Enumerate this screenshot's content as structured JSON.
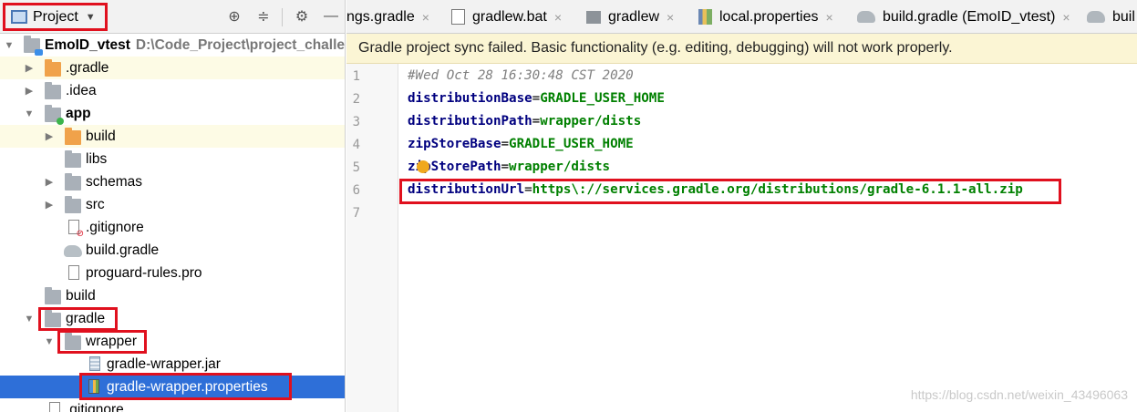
{
  "project_panel": {
    "view_selector_label": "Project",
    "tree": [
      {
        "label": "EmoID_vtest",
        "path": "D:\\Code_Project\\project_challe",
        "kind": "root"
      },
      {
        "label": ".gradle",
        "kind": "folder-orange"
      },
      {
        "label": ".idea",
        "kind": "folder"
      },
      {
        "label": "app",
        "kind": "module"
      },
      {
        "label": "build",
        "kind": "folder-orange"
      },
      {
        "label": "libs",
        "kind": "folder"
      },
      {
        "label": "schemas",
        "kind": "folder"
      },
      {
        "label": "src",
        "kind": "folder"
      },
      {
        "label": ".gitignore",
        "kind": "file-ignore"
      },
      {
        "label": "build.gradle",
        "kind": "gradle"
      },
      {
        "label": "proguard-rules.pro",
        "kind": "file"
      },
      {
        "label": "build",
        "kind": "folder"
      },
      {
        "label": "gradle",
        "kind": "folder"
      },
      {
        "label": "wrapper",
        "kind": "folder"
      },
      {
        "label": "gradle-wrapper.jar",
        "kind": "jar"
      },
      {
        "label": "gradle-wrapper.properties",
        "kind": "properties"
      },
      {
        "label": ".gitignore",
        "kind": "file-ignore"
      }
    ]
  },
  "tabs": [
    {
      "label": "ngs.gradle",
      "icon": "gradle-icon"
    },
    {
      "label": "gradlew.bat",
      "icon": "file-icon"
    },
    {
      "label": "gradlew",
      "icon": "terminal-icon"
    },
    {
      "label": "local.properties",
      "icon": "properties-icon"
    },
    {
      "label": "build.gradle (EmoID_vtest)",
      "icon": "gradle-icon"
    },
    {
      "label": "buil",
      "icon": "gradle-icon"
    }
  ],
  "tab_close_glyph": "×",
  "warning": "Gradle project sync failed. Basic functionality (e.g. editing, debugging) will not work properly.",
  "editor": {
    "line_numbers": [
      "1",
      "2",
      "3",
      "4",
      "5",
      "6",
      "7"
    ],
    "lines": [
      {
        "comment": "#Wed Oct 28 16:30:48 CST 2020"
      },
      {
        "key": "distributionBase",
        "eq": "=",
        "value": "GRADLE_USER_HOME"
      },
      {
        "key": "distributionPath",
        "eq": "=",
        "value": "wrapper/dists"
      },
      {
        "key": "zipStoreBase",
        "eq": "=",
        "value": "GRADLE_USER_HOME"
      },
      {
        "key": "zipStorePath",
        "eq": "=",
        "value": "wrapper/dists"
      },
      {
        "key": "distributionUrl",
        "eq": "=",
        "value": "https\\://services.gradle.org/distributions/gradle-6.1.1-all.zip"
      },
      {}
    ]
  },
  "watermark": "https://blog.csdn.net/weixin_43496063"
}
